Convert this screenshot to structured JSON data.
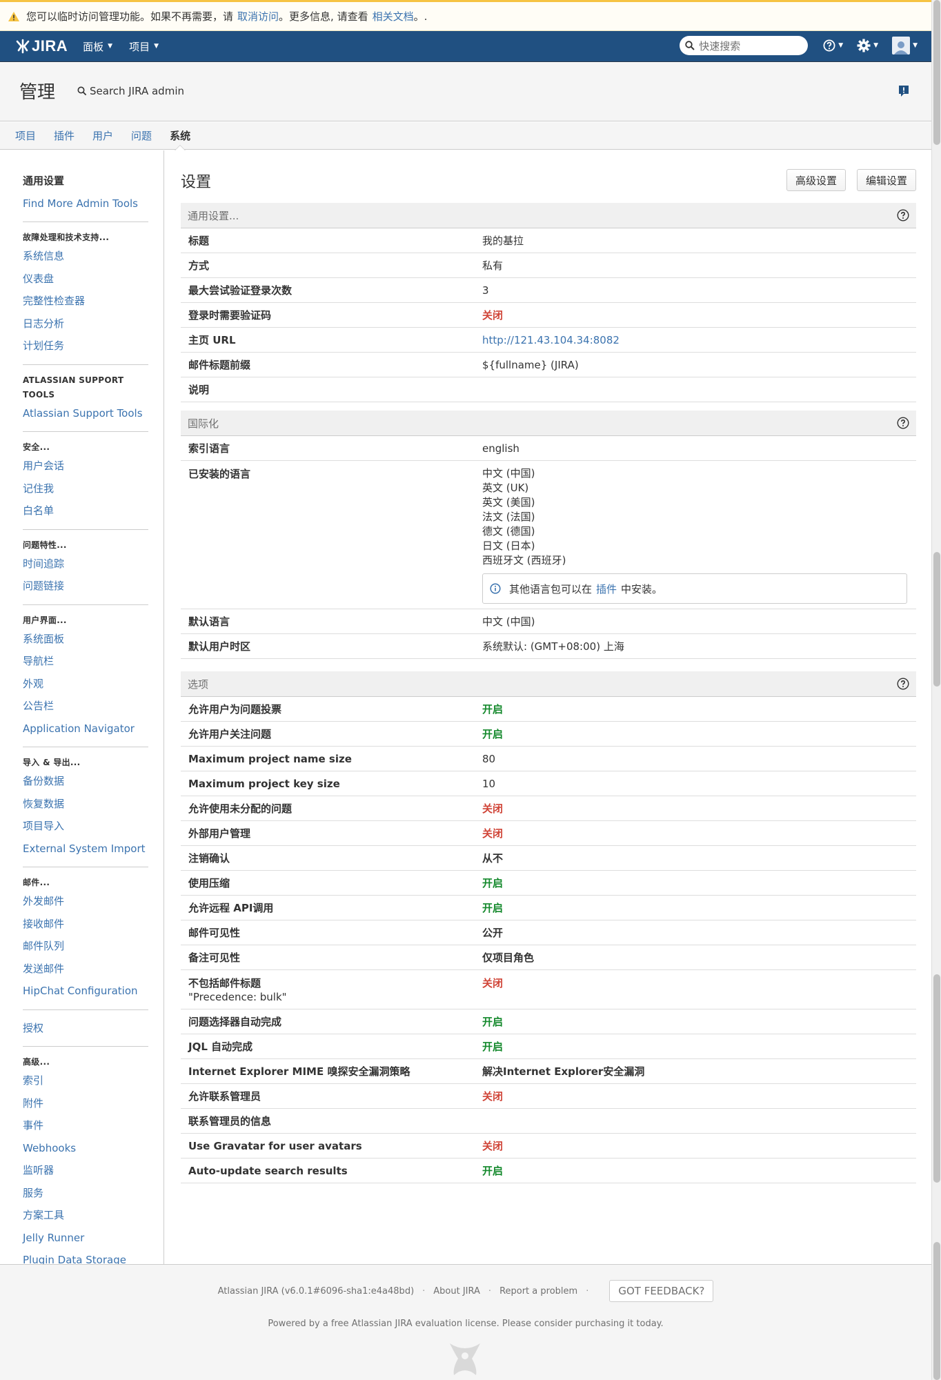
{
  "banner": {
    "text1": "您可以临时访问管理功能。如果不再需要，请",
    "link1": "取消访问",
    "text2": "。更多信息, 请查看",
    "link2": "相关文档",
    "text3": "。."
  },
  "header": {
    "logo": "JIRA",
    "nav": [
      "面板",
      "项目"
    ],
    "search_placeholder": "快速搜索"
  },
  "admin": {
    "title": "管理",
    "search": "Search JIRA admin"
  },
  "tabs": [
    "项目",
    "插件",
    "用户",
    "问题",
    "系统"
  ],
  "sidebar": [
    {
      "head": "",
      "items": [
        {
          "label": "通用设置",
          "active": true
        },
        {
          "label": "Find More Admin Tools"
        }
      ]
    },
    {
      "head": "故障处理和技术支持...",
      "items": [
        {
          "label": "系统信息"
        },
        {
          "label": "仪表盘"
        },
        {
          "label": "完整性检查器"
        },
        {
          "label": "日志分析"
        },
        {
          "label": "计划任务"
        }
      ]
    },
    {
      "head": "ATLASSIAN SUPPORT TOOLS",
      "items": [
        {
          "label": "Atlassian Support Tools"
        }
      ]
    },
    {
      "head": "安全...",
      "items": [
        {
          "label": "用户会话"
        },
        {
          "label": "记住我"
        },
        {
          "label": "白名单"
        }
      ]
    },
    {
      "head": "问题特性...",
      "items": [
        {
          "label": "时间追踪"
        },
        {
          "label": "问题链接"
        }
      ]
    },
    {
      "head": "用户界面...",
      "items": [
        {
          "label": "系统面板"
        },
        {
          "label": "导航栏"
        },
        {
          "label": "外观"
        },
        {
          "label": "公告栏"
        },
        {
          "label": "Application Navigator"
        }
      ]
    },
    {
      "head": "导入 & 导出...",
      "items": [
        {
          "label": "备份数据"
        },
        {
          "label": "恢复数据"
        },
        {
          "label": "项目导入"
        },
        {
          "label": "External System Import"
        }
      ]
    },
    {
      "head": "邮件...",
      "items": [
        {
          "label": "外发邮件"
        },
        {
          "label": "接收邮件"
        },
        {
          "label": "邮件队列"
        },
        {
          "label": "发送邮件"
        },
        {
          "label": "HipChat Configuration"
        }
      ]
    },
    {
      "head": "",
      "items": [
        {
          "label": "授权"
        }
      ]
    },
    {
      "head": "高级...",
      "items": [
        {
          "label": "索引"
        },
        {
          "label": "附件"
        },
        {
          "label": "事件"
        },
        {
          "label": "Webhooks"
        },
        {
          "label": "监听器"
        },
        {
          "label": "服务"
        },
        {
          "label": "方案工具"
        },
        {
          "label": "Jelly Runner"
        },
        {
          "label": "Plugin Data Storage"
        }
      ]
    }
  ],
  "page": {
    "title": "设置",
    "btn_advanced": "高级设置",
    "btn_edit": "编辑设置"
  },
  "general": {
    "head": "通用设置...",
    "rows": [
      {
        "k": "标题",
        "v": "我的基拉",
        "s": ""
      },
      {
        "k": "方式",
        "v": "私有",
        "s": ""
      },
      {
        "k": "最大尝试验证登录次数",
        "v": "3",
        "s": ""
      },
      {
        "k": "登录时需要验证码",
        "v": "关闭",
        "s": "off"
      },
      {
        "k": "主页 URL",
        "v": "http://121.43.104.34:8082",
        "s": "link"
      },
      {
        "k": "邮件标题前缀",
        "v": "${fullname} (JIRA)",
        "s": ""
      },
      {
        "k": "说明",
        "v": "",
        "s": ""
      }
    ]
  },
  "i18n": {
    "head": "国际化",
    "index_lang_k": "索引语言",
    "index_lang_v": "english",
    "installed_k": "已安装的语言",
    "installed": [
      "中文 (中国)",
      "英文 (UK)",
      "英文 (美国)",
      "法文 (法国)",
      "德文 (德国)",
      "日文 (日本)",
      "西班牙文 (西班牙)"
    ],
    "info_text1": "其他语言包可以在",
    "info_link": "插件",
    "info_text2": "中安装。",
    "default_lang_k": "默认语言",
    "default_lang_v": "中文 (中国)",
    "tz_k": "默认用户时区",
    "tz_v": "系统默认: (GMT+08:00) 上海"
  },
  "options": {
    "head": "选项",
    "rows": [
      {
        "k": "允许用户为问题投票",
        "v": "开启",
        "s": "on"
      },
      {
        "k": "允许用户关注问题",
        "v": "开启",
        "s": "on"
      },
      {
        "k": "Maximum project name size",
        "v": "80",
        "s": ""
      },
      {
        "k": "Maximum project key size",
        "v": "10",
        "s": ""
      },
      {
        "k": "允许使用未分配的问题",
        "v": "关闭",
        "s": "off"
      },
      {
        "k": "外部用户管理",
        "v": "关闭",
        "s": "off"
      },
      {
        "k": "注销确认",
        "v": "从不",
        "s": "strong"
      },
      {
        "k": "使用压缩",
        "v": "开启",
        "s": "on"
      },
      {
        "k": "允许远程 API调用",
        "v": "开启",
        "s": "on"
      },
      {
        "k": "邮件可见性",
        "v": "公开",
        "s": "strong"
      },
      {
        "k": "备注可见性",
        "v": "仅项目角色",
        "s": "strong"
      },
      {
        "k": "不包括邮件标题",
        "sub": "\"Precedence: bulk\"",
        "v": "关闭",
        "s": "off"
      },
      {
        "k": "问题选择器自动完成",
        "v": "开启",
        "s": "on"
      },
      {
        "k": "JQL 自动完成",
        "v": "开启",
        "s": "on"
      },
      {
        "k": "Internet Explorer MIME 嗅探安全漏洞策略",
        "v": "解决Internet Explorer安全漏洞",
        "s": "strong"
      },
      {
        "k": "允许联系管理员",
        "v": "关闭",
        "s": "off"
      },
      {
        "k": "联系管理员的信息",
        "v": "",
        "s": ""
      },
      {
        "k": "Use Gravatar for user avatars",
        "v": "关闭",
        "s": "off"
      },
      {
        "k": "Auto-update search results",
        "v": "开启",
        "s": "on"
      }
    ]
  },
  "footer": {
    "version": "Atlassian JIRA (v6.0.1#6096-sha1:e4a48bd)",
    "about": "About JIRA",
    "report": "Report a problem",
    "feedback": "GOT FEEDBACK?",
    "powered": "Powered by a free Atlassian JIRA evaluation license. Please consider purchasing it today."
  },
  "colors": {
    "header": "#205081",
    "link": "#3b73af",
    "on": "#14892c",
    "off": "#d04437"
  }
}
